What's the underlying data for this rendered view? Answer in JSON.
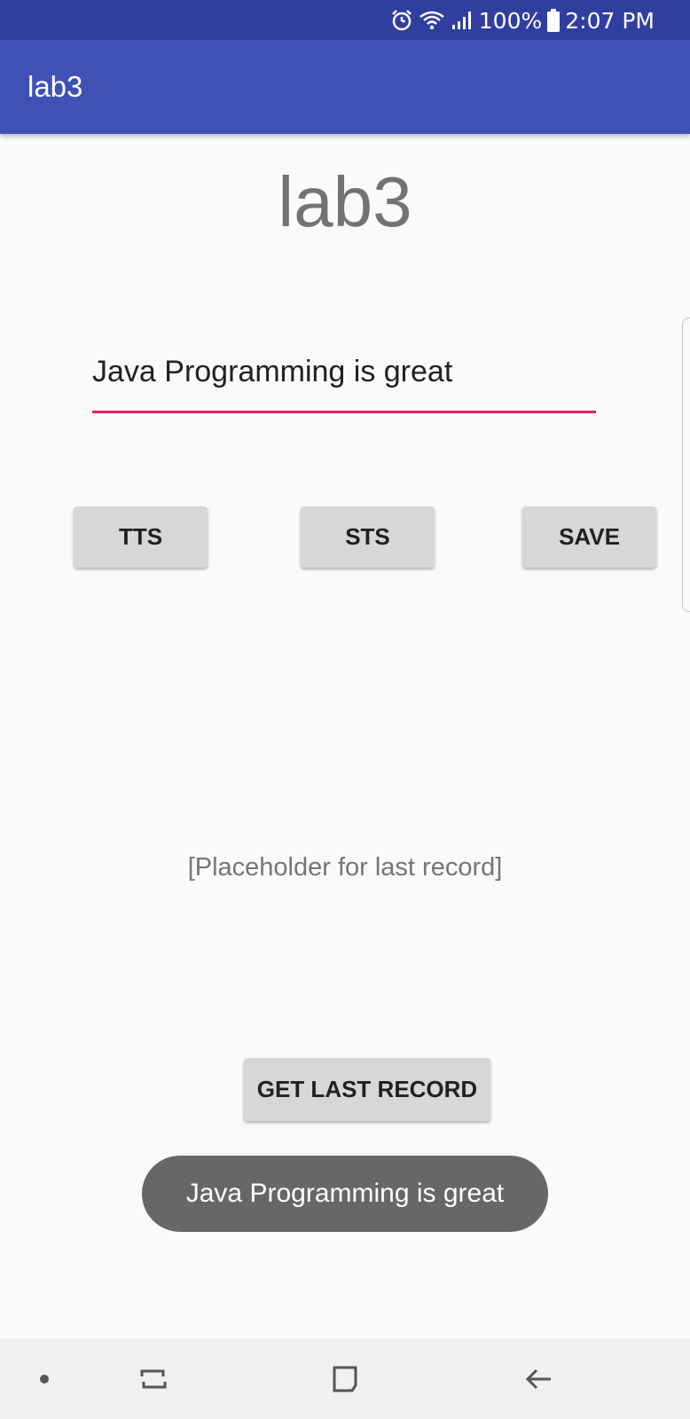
{
  "status_bar": {
    "battery_text": "100%",
    "time": "2:07 PM",
    "icons": [
      "alarm-icon",
      "wifi-icon",
      "signal-icon",
      "battery-icon"
    ]
  },
  "app_bar": {
    "title": "lab3"
  },
  "main": {
    "title": "lab3",
    "input_value": "Java Programming is great",
    "buttons": {
      "tts": "TTS",
      "sts": "STS",
      "save": "SAVE",
      "get_last_record": "GET LAST RECORD"
    },
    "last_record_text": "[Placeholder for last record]"
  },
  "toast": {
    "message": "Java Programming is great"
  },
  "nav_bar": {
    "icons": [
      "dot-icon",
      "recents-icon",
      "home-icon",
      "back-icon"
    ]
  },
  "colors": {
    "status_bar": "#303f9f",
    "app_bar": "#3f51b5",
    "accent": "#e91e63",
    "toast": "#676767"
  }
}
